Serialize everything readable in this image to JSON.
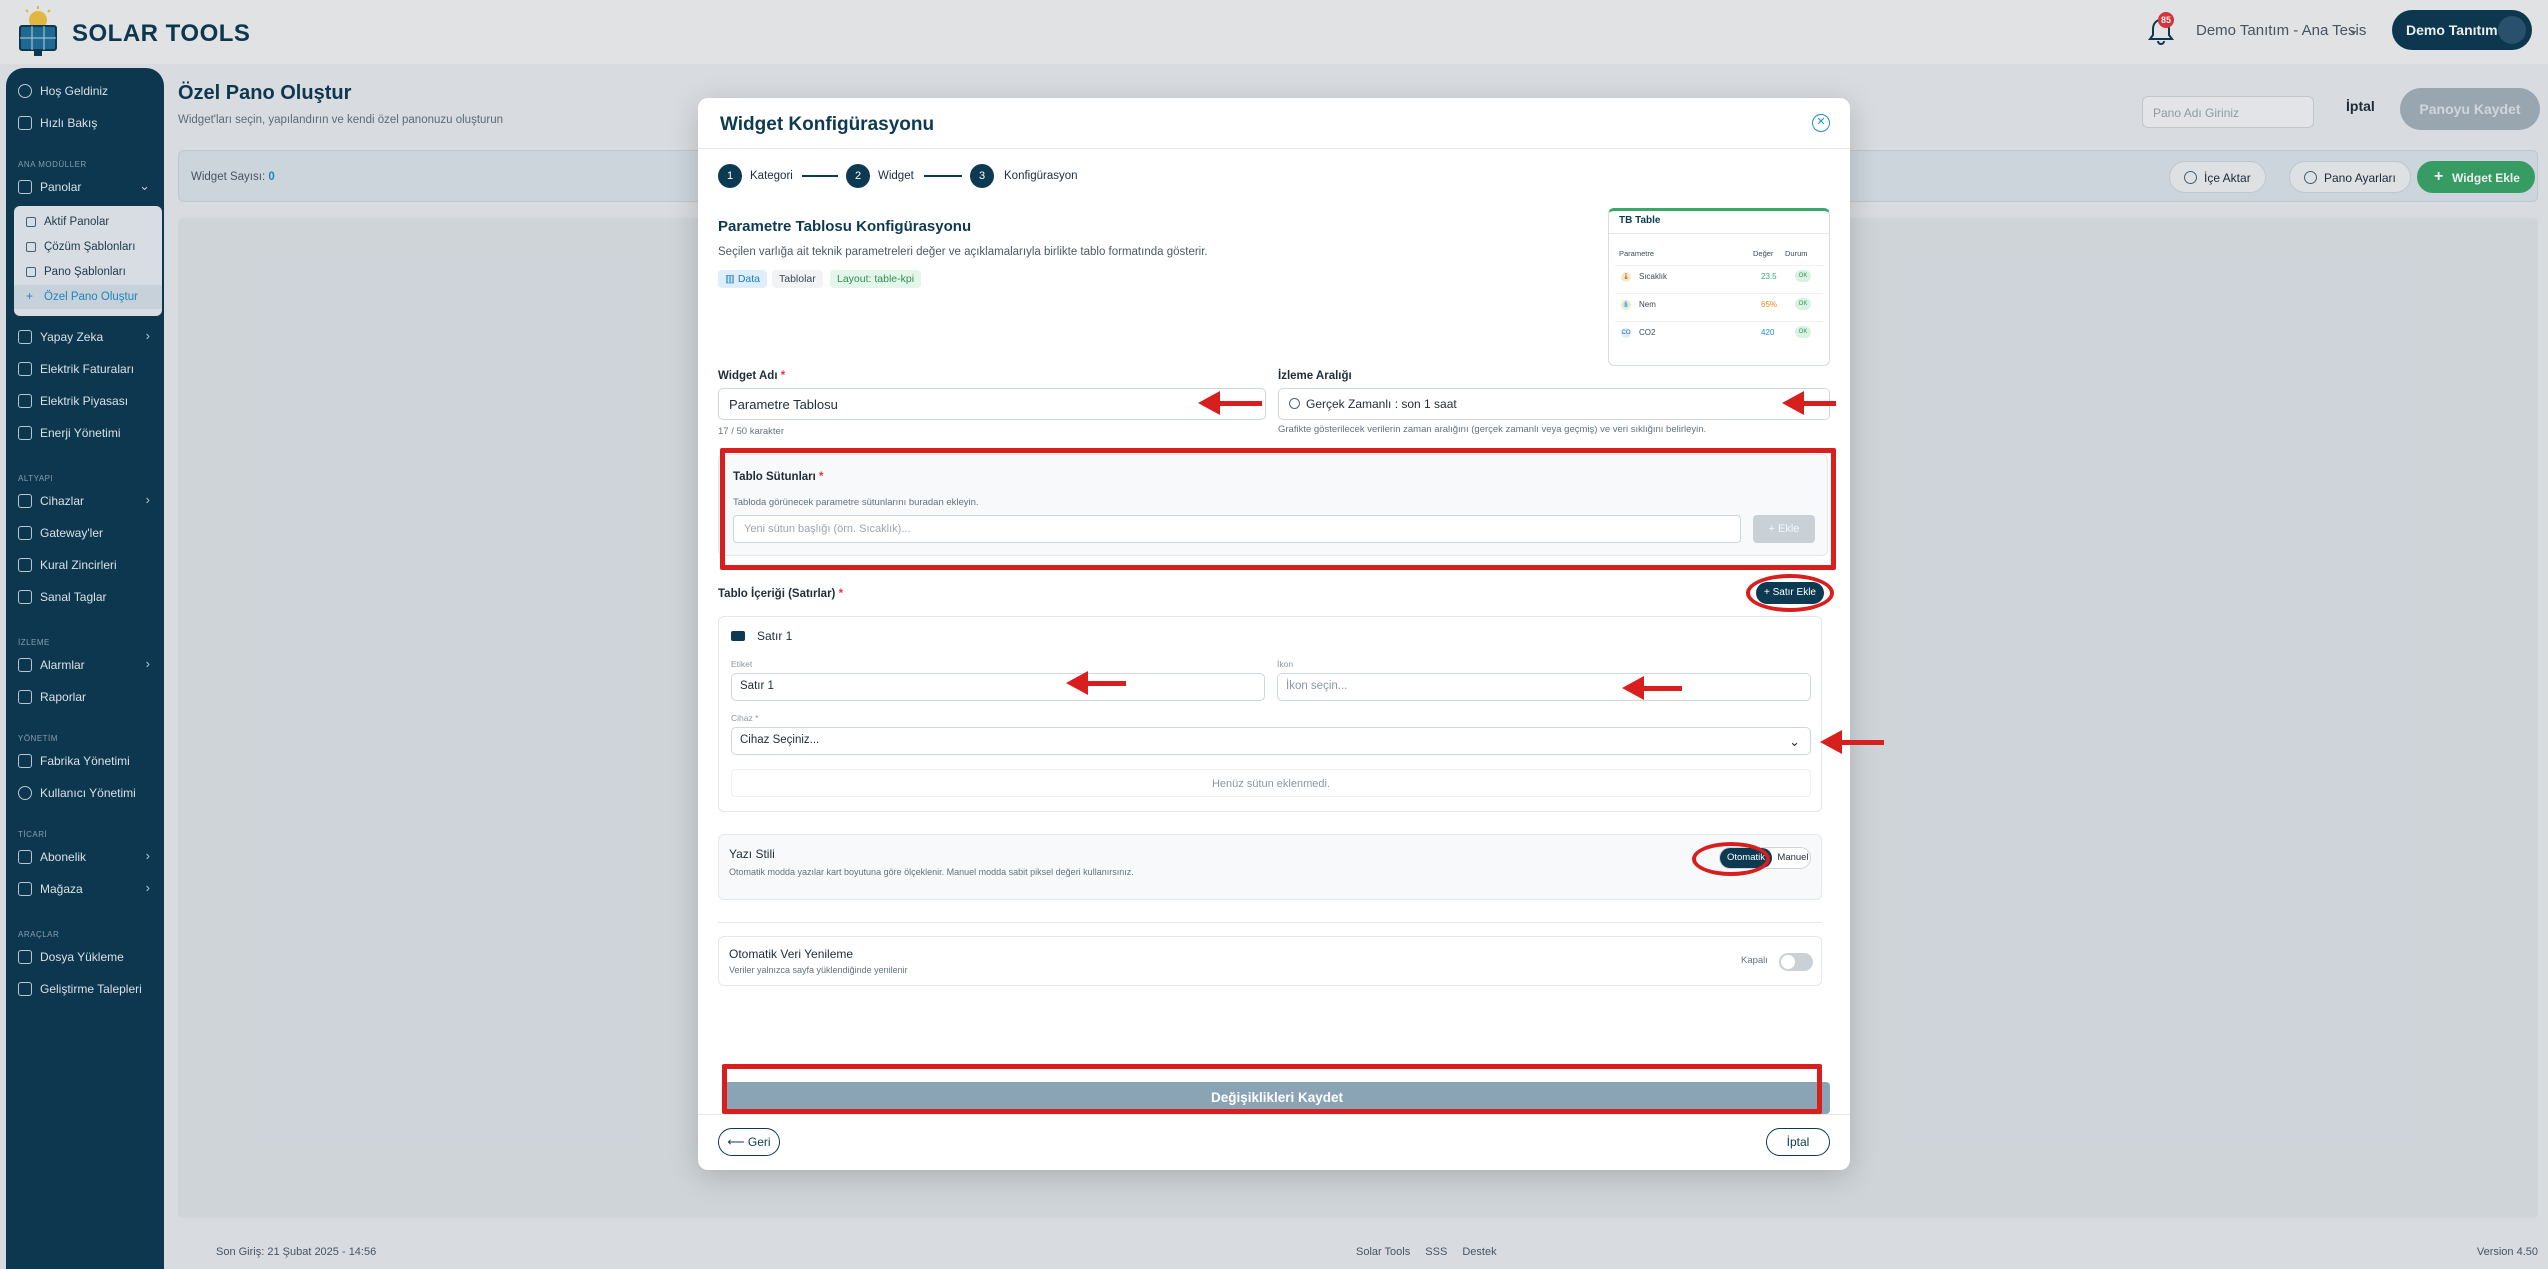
{
  "header": {
    "app_name": "SOLAR TOOLS",
    "notification_count": "85",
    "tenant": "Demo Tanıtım - Ana Tesis",
    "user_button": "Demo Tanıtım"
  },
  "sidebar": {
    "items_top": [
      {
        "label": "Hoş Geldiniz",
        "icon": "star-icon"
      },
      {
        "label": "Hızlı Bakış",
        "icon": "grid-icon"
      }
    ],
    "section_main": "ANA MODÜLLER",
    "panolar": "Panolar",
    "submenu": [
      {
        "label": "Aktif Panolar"
      },
      {
        "label": "Çözüm Şablonları"
      },
      {
        "label": "Pano Şablonları"
      },
      {
        "label": "Özel Pano Oluştur"
      }
    ],
    "main_items": [
      {
        "label": "Yapay Zeka",
        "has_chevron": true
      },
      {
        "label": "Elektrik Faturaları",
        "has_chevron": false
      },
      {
        "label": "Elektrik Piyasası",
        "has_chevron": false
      },
      {
        "label": "Enerji Yönetimi",
        "has_chevron": false
      }
    ],
    "section_infra": "ALTYAPI",
    "infra_items": [
      {
        "label": "Cihazlar",
        "has_chevron": true
      },
      {
        "label": "Gateway'ler",
        "has_chevron": false
      },
      {
        "label": "Kural Zincirleri",
        "has_chevron": false
      },
      {
        "label": "Sanal Taglar",
        "has_chevron": false
      }
    ],
    "section_monitor": "İZLEME",
    "monitor_items": [
      {
        "label": "Alarmlar",
        "has_chevron": true
      },
      {
        "label": "Raporlar",
        "has_chevron": false
      }
    ],
    "section_admin": "YÖNETİM",
    "admin_items": [
      {
        "label": "Fabrika Yönetimi"
      },
      {
        "label": "Kullanıcı Yönetimi"
      }
    ],
    "section_commerce": "TİCARİ",
    "commerce_items": [
      {
        "label": "Abonelik",
        "has_chevron": true
      },
      {
        "label": "Mağaza",
        "has_chevron": true
      }
    ],
    "section_tools": "ARAÇLAR",
    "tools_items": [
      {
        "label": "Dosya Yükleme"
      },
      {
        "label": "Geliştirme Talepleri"
      }
    ]
  },
  "page": {
    "title": "Özel Pano Oluştur",
    "subtitle": "Widget'ları seçin, yapılandırın ve kendi özel panonuzu oluşturun",
    "pano_name_placeholder": "Pano Adı Giriniz",
    "cancel": "İptal",
    "save": "Panoyu Kaydet",
    "widget_count_label": "Widget Sayısı:",
    "widget_count": "0",
    "import": "İçe Aktar",
    "settings": "Pano Ayarları",
    "add_widget": "Widget Ekle"
  },
  "footer": {
    "last_login": "Son Giriş: 21 Şubat 2025 - 14:56",
    "links": [
      "Solar Tools",
      "SSS",
      "Destek"
    ],
    "version": "Version 4.50"
  },
  "modal": {
    "title": "Widget Konfigürasyonu",
    "steps": [
      {
        "num": "1",
        "label": "Kategori"
      },
      {
        "num": "2",
        "label": "Widget"
      },
      {
        "num": "3",
        "label": "Konfigürasyon"
      }
    ],
    "section_title": "Parametre Tablosu Konfigürasyonu",
    "section_desc": "Seçilen varlığa ait teknik parametreleri değer ve açıklamalarıyla birlikte tablo formatında gösterir.",
    "tags": [
      "Data",
      "Tablolar",
      "Layout: table-kpi"
    ],
    "preview": {
      "title": "TB Table",
      "headers": [
        "Parametre",
        "Değer",
        "Durum"
      ],
      "rows": [
        {
          "icon": "🌡",
          "name": "Sıcaklık",
          "value": "23.5",
          "status": "OK",
          "color": "#3aa86a"
        },
        {
          "icon": "💧",
          "name": "Nem",
          "value": "65%",
          "status": "OK",
          "color": "#e08a1e"
        },
        {
          "icon": "CO",
          "name": "CO2",
          "value": "420",
          "status": "OK",
          "color": "#1f8fc9"
        }
      ]
    },
    "widget_name_label": "Widget Adı",
    "widget_name_value": "Parametre Tablosu",
    "widget_name_count": "17 / 50 karakter",
    "interval_label": "İzleme Aralığı",
    "interval_value": "Gerçek Zamanlı : son 1 saat",
    "interval_hint": "Grafikte gösterilecek verilerin zaman aralığını (gerçek zamanlı veya geçmiş) ve veri sıklığını belirleyin.",
    "columns_label": "Tablo Sütunları",
    "columns_desc": "Tabloda görünecek parametre sütunlarını buradan ekleyin.",
    "columns_placeholder": "Yeni sütun başlığı (örn. Sıcaklık)...",
    "columns_add": "+ Ekle",
    "rows_label": "Tablo İçeriği (Satırlar)",
    "add_row": "+ Satır Ekle",
    "row": {
      "title": "Satır 1",
      "name_label": "Etiket",
      "name_value": "Satır 1",
      "icon_label": "İkon",
      "icon_placeholder": "İkon seçin...",
      "device_label": "Cihaz",
      "device_value": "Cihaz Seçiniz...",
      "empty_cols": "Henüz sütun eklenmedi."
    },
    "font_style_title": "Yazı Stili",
    "font_style_desc": "Otomatik modda yazılar kart boyutuna göre ölçeklenir. Manuel modda sabit piksel değeri kullanırsınız.",
    "font_auto": "Otomatik",
    "font_manual": "Manuel",
    "auto_refresh_title": "Otomatik Veri Yenileme",
    "auto_refresh_desc": "Veriler yalnızca sayfa yüklendiğinde yenilenir",
    "auto_refresh_state": "Kapalı",
    "save_changes": "Değişiklikleri Kaydet",
    "back": "⟵ Geri",
    "cancel": "İptal"
  }
}
